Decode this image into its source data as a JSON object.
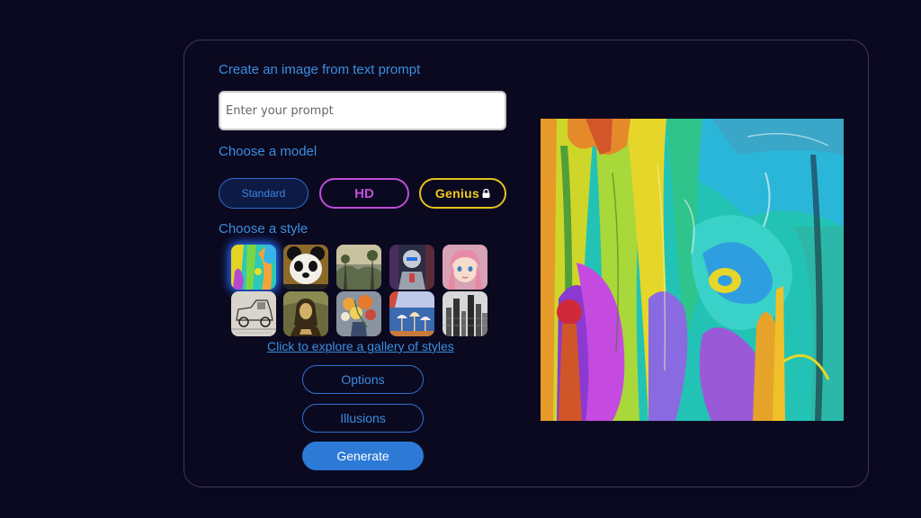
{
  "form": {
    "title": "Create an image from text prompt",
    "prompt_placeholder": "Enter your prompt",
    "prompt_value": ""
  },
  "model": {
    "heading": "Choose a model",
    "options": [
      "Standard",
      "HD",
      "Genius"
    ],
    "selected": "Standard",
    "locked": [
      "Genius"
    ]
  },
  "style": {
    "heading": "Choose a style",
    "thumbnails": [
      "abstract-colorful-painting",
      "panda",
      "misty-landscape",
      "robot",
      "anime-girl",
      "sketch-car",
      "mona-lisa",
      "flower-still-life",
      "ballet-dancers",
      "ink-city"
    ],
    "selected_index": 0,
    "gallery_link": "Click to explore a gallery of styles"
  },
  "actions": {
    "options": "Options",
    "illusions": "Illusions",
    "generate": "Generate"
  },
  "preview": {
    "image": "abstract-colorful-painting"
  },
  "colors": {
    "background": "#0a0820",
    "accent_blue": "#3a8ee0",
    "hd_purple": "#c04ed8",
    "genius_gold": "#f1c81a",
    "generate_button": "#2d7ad6"
  }
}
